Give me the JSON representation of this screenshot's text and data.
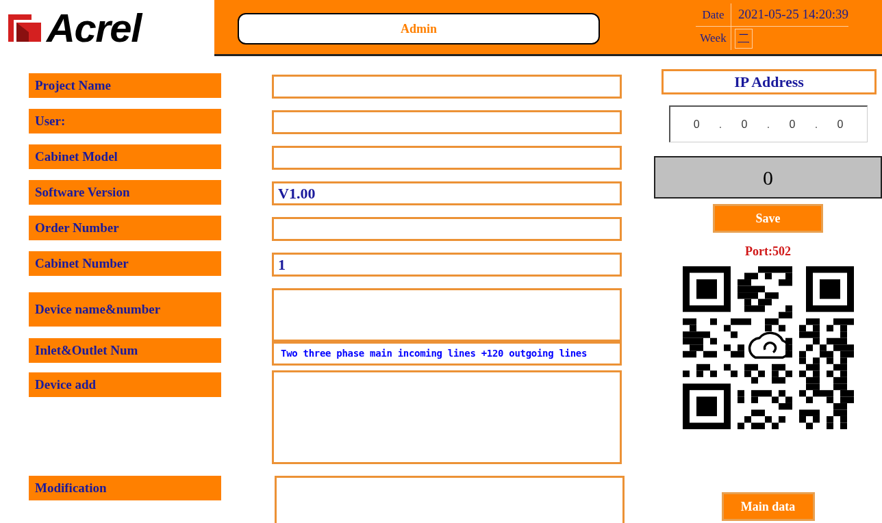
{
  "header": {
    "logo": "Acrel",
    "user": "Admin",
    "date_label": "Date",
    "date": "2021-05-25 14:20:39",
    "week_label": "Week",
    "week": "二"
  },
  "fields": [
    {
      "label": "Project Name",
      "kind": "line"
    },
    {
      "label": "User:",
      "kind": "line"
    },
    {
      "label": "Cabinet Model",
      "kind": "line"
    },
    {
      "label": "Software Version",
      "kind": "line",
      "value": "V1.00"
    },
    {
      "label": "Order Number",
      "kind": "line"
    },
    {
      "label": "Cabinet Number",
      "kind": "line",
      "value": "1"
    },
    {
      "label": "Device name&number",
      "kind": "box"
    },
    {
      "label": "Inlet&Outlet Num",
      "kind": "text",
      "value": "Two three phase main incoming lines +120 outgoing lines"
    },
    {
      "label": "Device add",
      "kind": "area"
    },
    {
      "label": "Modification",
      "kind": "note"
    }
  ],
  "network": {
    "title": "IP Address",
    "octets": [
      "0",
      "0",
      "0",
      "0"
    ],
    "separator": ".",
    "display": "0",
    "save": "Save",
    "port": "Port:502",
    "main_button": "Main data"
  }
}
